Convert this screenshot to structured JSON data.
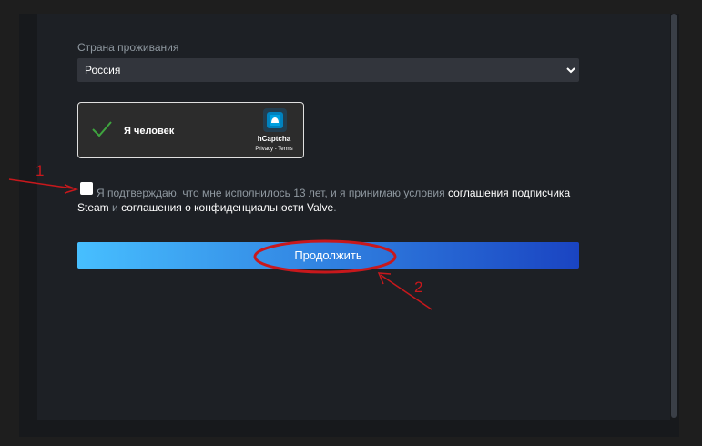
{
  "form": {
    "country_label": "Страна проживания",
    "country_value": "Россия",
    "captcha": {
      "label": "Я человек",
      "brand": "hCaptcha",
      "links": "Privacy - Terms"
    },
    "agreement": {
      "prefix": "Я подтверждаю, что мне исполнилось 13 лет, и я принимаю условия",
      "subscriber_link": "соглашения подписчика Steam",
      "conjunction": "и",
      "privacy_link": "соглашения о конфиденциальности Valve",
      "suffix": ".",
      "checked": false
    },
    "continue_label": "Продолжить"
  },
  "annotations": {
    "marker_1": "1",
    "marker_2": "2",
    "color": "#c8181c"
  },
  "colors": {
    "button_gradient_start": "#47bfff",
    "button_gradient_end": "#1a44c2",
    "check_color": "#3fa43f"
  }
}
